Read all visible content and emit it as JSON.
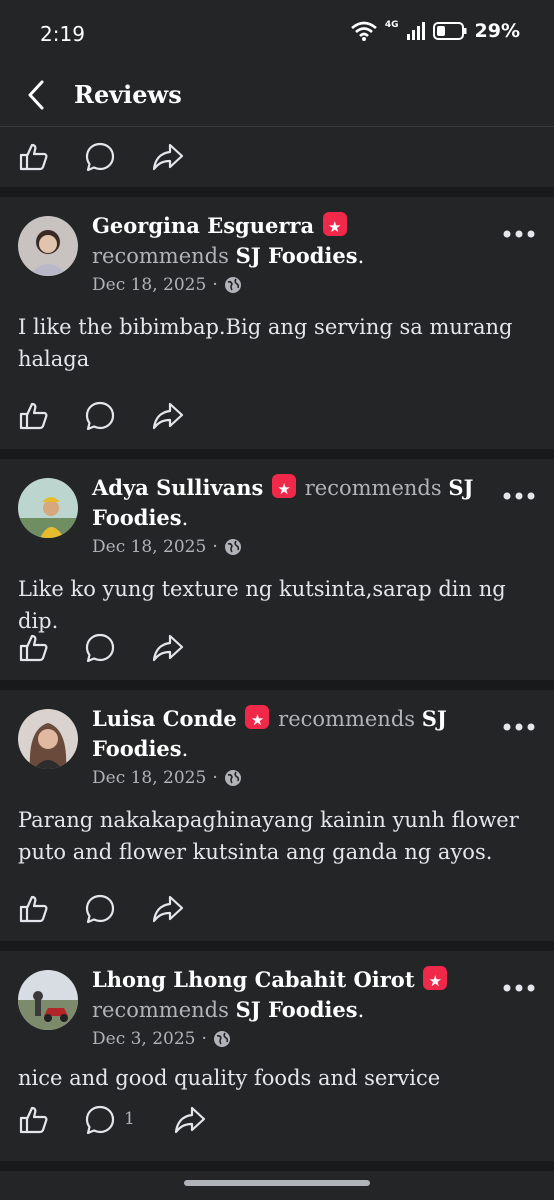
{
  "status": {
    "time": "2:19",
    "network": "4G",
    "battery": "29%"
  },
  "header": {
    "title": "Reviews"
  },
  "posts": [
    {
      "name": "Georgina Esguerra",
      "recommends": "recommends",
      "page": "SJ Foodies",
      "date": "Dec 18, 2025",
      "text": "I like the bibimbap.Big ang serving sa murang halaga"
    },
    {
      "name": "Adya Sullivans",
      "recommends": "recommends",
      "page": "SJ Foodies",
      "date": "Dec 18, 2025",
      "text": "Like ko yung texture ng kutsinta,sarap din ng dip."
    },
    {
      "name": "Luisa Conde",
      "recommends": "recommends",
      "page": "SJ Foodies",
      "date": "Dec 18, 2025",
      "text": "Parang nakakapaghinayang kainin yunh flower puto and flower kutsinta ang ganda ng ayos."
    },
    {
      "name": "Lhong Lhong Cabahit Oirot",
      "recommends": "recommends",
      "page": "SJ Foodies",
      "date": "Dec 3, 2025",
      "text": "nice and good quality foods and service",
      "comment_count": "1"
    }
  ],
  "icons": [
    "back-icon",
    "like-icon",
    "comment-icon",
    "share-icon",
    "more-icon",
    "globe-icon",
    "star-badge-icon",
    "wifi-icon",
    "signal-icon",
    "battery-icon"
  ],
  "colors": {
    "background": "#242526",
    "divider": "#18191a",
    "badge": "#f02849",
    "muted": "#b0b3b8"
  }
}
